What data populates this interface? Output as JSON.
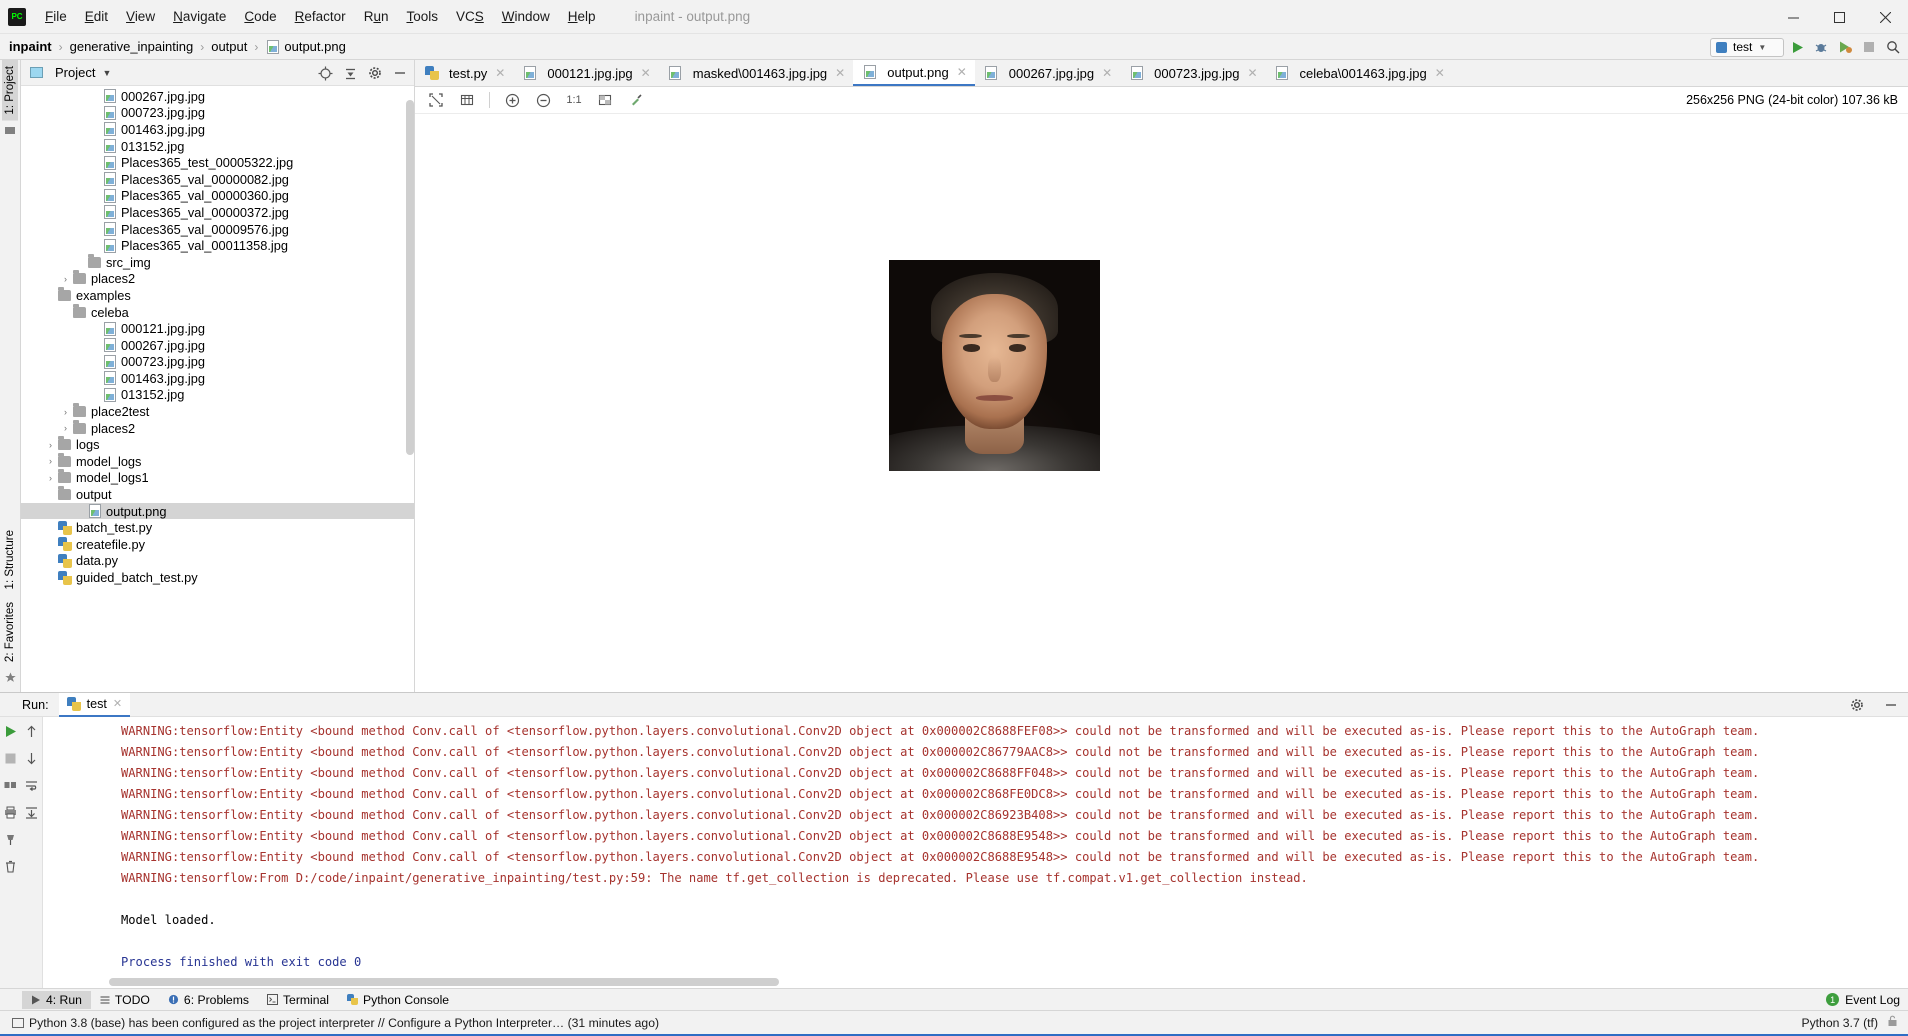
{
  "window": {
    "app_icon": "pycharm-icon",
    "title": "inpaint - output.png",
    "menus": [
      "File",
      "Edit",
      "View",
      "Navigate",
      "Code",
      "Refactor",
      "Run",
      "Tools",
      "VCS",
      "Window",
      "Help"
    ],
    "controls": {
      "minimize": "─",
      "maximize": "☐",
      "close": "✕"
    }
  },
  "breadcrumb": {
    "items": [
      "inpaint",
      "generative_inpainting",
      "output",
      "output.png"
    ],
    "separator": "›"
  },
  "toolbar": {
    "run_config": "test",
    "run_label": "Run",
    "debug_label": "Debug",
    "coverage_label": "Run with Coverage",
    "stop_label": "Stop",
    "search_label": "Search Everywhere"
  },
  "project_pane": {
    "title": "Project",
    "vertical_tabs": [
      "1: Project",
      "2: Favorites",
      "1: Structure"
    ],
    "tree": [
      {
        "indent": 5,
        "type": "image",
        "label": "000267.jpg.jpg",
        "twisty": "",
        "selected": false
      },
      {
        "indent": 5,
        "type": "image",
        "label": "000723.jpg.jpg",
        "twisty": "",
        "selected": false
      },
      {
        "indent": 5,
        "type": "image",
        "label": "001463.jpg.jpg",
        "twisty": "",
        "selected": false
      },
      {
        "indent": 5,
        "type": "image",
        "label": "013152.jpg",
        "twisty": "",
        "selected": false
      },
      {
        "indent": 5,
        "type": "image",
        "label": "Places365_test_00005322.jpg",
        "twisty": "",
        "selected": false
      },
      {
        "indent": 5,
        "type": "image",
        "label": "Places365_val_00000082.jpg",
        "twisty": "",
        "selected": false
      },
      {
        "indent": 5,
        "type": "image",
        "label": "Places365_val_00000360.jpg",
        "twisty": "",
        "selected": false
      },
      {
        "indent": 5,
        "type": "image",
        "label": "Places365_val_00000372.jpg",
        "twisty": "",
        "selected": false
      },
      {
        "indent": 5,
        "type": "image",
        "label": "Places365_val_00009576.jpg",
        "twisty": "",
        "selected": false
      },
      {
        "indent": 5,
        "type": "image",
        "label": "Places365_val_00011358.jpg",
        "twisty": "",
        "selected": false
      },
      {
        "indent": 4,
        "type": "folder",
        "label": "src_img",
        "twisty": "",
        "selected": false
      },
      {
        "indent": 3,
        "type": "folder",
        "label": "places2",
        "twisty": "›",
        "selected": false
      },
      {
        "indent": 2,
        "type": "folder",
        "label": "examples",
        "twisty": "ⱟ",
        "selected": false
      },
      {
        "indent": 3,
        "type": "folder",
        "label": "celeba",
        "twisty": "ⱟ",
        "selected": false
      },
      {
        "indent": 5,
        "type": "image",
        "label": "000121.jpg.jpg",
        "twisty": "",
        "selected": false
      },
      {
        "indent": 5,
        "type": "image",
        "label": "000267.jpg.jpg",
        "twisty": "",
        "selected": false
      },
      {
        "indent": 5,
        "type": "image",
        "label": "000723.jpg.jpg",
        "twisty": "",
        "selected": false
      },
      {
        "indent": 5,
        "type": "image",
        "label": "001463.jpg.jpg",
        "twisty": "",
        "selected": false
      },
      {
        "indent": 5,
        "type": "image",
        "label": "013152.jpg",
        "twisty": "",
        "selected": false
      },
      {
        "indent": 3,
        "type": "folder",
        "label": "place2test",
        "twisty": "›",
        "selected": false
      },
      {
        "indent": 3,
        "type": "folder",
        "label": "places2",
        "twisty": "›",
        "selected": false
      },
      {
        "indent": 2,
        "type": "folder",
        "label": "logs",
        "twisty": "›",
        "selected": false
      },
      {
        "indent": 2,
        "type": "folder",
        "label": "model_logs",
        "twisty": "›",
        "selected": false
      },
      {
        "indent": 2,
        "type": "folder",
        "label": "model_logs1",
        "twisty": "›",
        "selected": false
      },
      {
        "indent": 2,
        "type": "folder",
        "label": "output",
        "twisty": "ⱟ",
        "selected": false
      },
      {
        "indent": 4,
        "type": "image",
        "label": "output.png",
        "twisty": "",
        "selected": true
      },
      {
        "indent": 2,
        "type": "python",
        "label": "batch_test.py",
        "twisty": "",
        "selected": false
      },
      {
        "indent": 2,
        "type": "python",
        "label": "createfile.py",
        "twisty": "",
        "selected": false
      },
      {
        "indent": 2,
        "type": "python",
        "label": "data.py",
        "twisty": "",
        "selected": false
      },
      {
        "indent": 2,
        "type": "python",
        "label": "guided_batch_test.py",
        "twisty": "",
        "selected": false
      }
    ]
  },
  "editor": {
    "tabs": [
      {
        "label": "test.py",
        "type": "python",
        "active": false
      },
      {
        "label": "000121.jpg.jpg",
        "type": "image",
        "active": false
      },
      {
        "label": "masked\\001463.jpg.jpg",
        "type": "image",
        "active": false
      },
      {
        "label": "output.png",
        "type": "image",
        "active": true
      },
      {
        "label": "000267.jpg.jpg",
        "type": "image",
        "active": false
      },
      {
        "label": "000723.jpg.jpg",
        "type": "image",
        "active": false
      },
      {
        "label": "celeba\\001463.jpg.jpg",
        "type": "image",
        "active": false
      }
    ],
    "image_toolbar": {
      "fit_label": "Fit zoom to window",
      "grid_label": "Toggle grid",
      "zoom_in_label": "Zoom in",
      "zoom_out_label": "Zoom out",
      "actual_size_label": "1:1",
      "transparency_label": "Toggle transparency chessboard",
      "color_picker_label": "Pick color"
    },
    "image_info": "256x256 PNG (24-bit color) 107.36 kB"
  },
  "run_window": {
    "label": "Run:",
    "tab": "test",
    "settings_label": "Settings",
    "hide_label": "Hide",
    "gutter_buttons": [
      "rerun",
      "up",
      "stop",
      "down",
      "print",
      "soft-wrap",
      "layout",
      "scroll-to-end",
      "pin",
      "clear-all"
    ],
    "console_lines": [
      {
        "style": "warn",
        "text": "WARNING:tensorflow:Entity <bound method Conv.call of <tensorflow.python.layers.convolutional.Conv2D object at 0x000002C8688FEF08>> could not be transformed and will be executed as-is. Please report this to the AutoGraph team."
      },
      {
        "style": "warn",
        "text": "WARNING:tensorflow:Entity <bound method Conv.call of <tensorflow.python.layers.convolutional.Conv2D object at 0x000002C86779AAC8>> could not be transformed and will be executed as-is. Please report this to the AutoGraph team."
      },
      {
        "style": "warn",
        "text": "WARNING:tensorflow:Entity <bound method Conv.call of <tensorflow.python.layers.convolutional.Conv2D object at 0x000002C8688FF048>> could not be transformed and will be executed as-is. Please report this to the AutoGraph team."
      },
      {
        "style": "warn",
        "text": "WARNING:tensorflow:Entity <bound method Conv.call of <tensorflow.python.layers.convolutional.Conv2D object at 0x000002C868FE0DC8>> could not be transformed and will be executed as-is. Please report this to the AutoGraph team."
      },
      {
        "style": "warn",
        "text": "WARNING:tensorflow:Entity <bound method Conv.call of <tensorflow.python.layers.convolutional.Conv2D object at 0x000002C86923B408>> could not be transformed and will be executed as-is. Please report this to the AutoGraph team."
      },
      {
        "style": "warn",
        "text": "WARNING:tensorflow:Entity <bound method Conv.call of <tensorflow.python.layers.convolutional.Conv2D object at 0x000002C8688E9548>> could not be transformed and will be executed as-is. Please report this to the AutoGraph team."
      },
      {
        "style": "warn",
        "text": "WARNING:tensorflow:Entity <bound method Conv.call of <tensorflow.python.layers.convolutional.Conv2D object at 0x000002C8688E9548>> could not be transformed and will be executed as-is. Please report this to the AutoGraph team."
      },
      {
        "style": "warn",
        "text": "WARNING:tensorflow:From D:/code/inpaint/generative_inpainting/test.py:59: The name tf.get_collection is deprecated. Please use tf.compat.v1.get_collection instead."
      },
      {
        "style": "blank",
        "text": ""
      },
      {
        "style": "plain",
        "text": "Model loaded."
      },
      {
        "style": "blank",
        "text": ""
      },
      {
        "style": "blue",
        "text": "Process finished with exit code 0"
      }
    ]
  },
  "bottom_bar": {
    "buttons": [
      {
        "label": "4: Run",
        "icon": "run-icon",
        "selected": true
      },
      {
        "label": "TODO",
        "icon": "todo-icon",
        "selected": false
      },
      {
        "label": "6: Problems",
        "icon": "problems-icon",
        "selected": false
      },
      {
        "label": "Terminal",
        "icon": "terminal-icon",
        "selected": false
      },
      {
        "label": "Python Console",
        "icon": "python-console-icon",
        "selected": false
      }
    ],
    "event_log": "Event Log",
    "event_count": "1"
  },
  "status_bar": {
    "message": "Python 3.8 (base) has been configured as the project interpreter // Configure a Python Interpreter… (31 minutes ago)",
    "interpreter": "Python 3.7 (tf)",
    "lock_icon": "lock-icon"
  },
  "colors": {
    "accent": "#3c77c4",
    "warning_text": "#a6332e",
    "success_text": "#283593",
    "selection": "#d4d4d4",
    "chrome": "#f2f2f2"
  }
}
